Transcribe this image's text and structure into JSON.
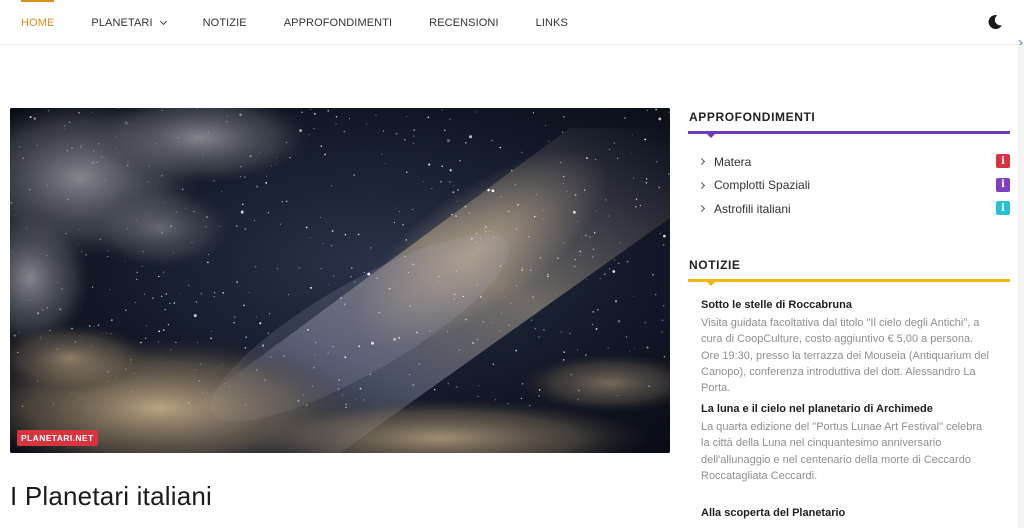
{
  "nav": {
    "items": [
      {
        "label": "HOME",
        "active": true
      },
      {
        "label": "PLANETARI",
        "has_dropdown": true
      },
      {
        "label": "NOTIZIE"
      },
      {
        "label": "APPROFONDIMENTI"
      },
      {
        "label": "RECENSIONI"
      },
      {
        "label": "LINKS"
      }
    ],
    "dark_mode_icon": "moon-icon",
    "accent_color": "#d9901a"
  },
  "hero": {
    "badge": "PLANETARI.NET",
    "badge_color": "#d8343f",
    "title": "I Planetari italiani"
  },
  "sidebar": {
    "approfondimenti": {
      "title": "APPROFONDIMENTI",
      "line_color": "#6f3cb5",
      "items": [
        {
          "label": "Matera",
          "badge_color": "#d8343f",
          "badge_icon": "info-icon"
        },
        {
          "label": "Complotti Spaziali",
          "badge_color": "#7e3fbf",
          "badge_icon": "info-icon"
        },
        {
          "label": "Astrofili italiani",
          "badge_color": "#27c0d6",
          "badge_icon": "info-icon"
        }
      ]
    },
    "notizie": {
      "title": "NOTIZIE",
      "line_color": "#f0b713",
      "items": [
        {
          "title": "Sotto le stelle di Roccabruna",
          "text": "Visita guidata facoltativa dal titolo \"Il cielo degli Antichi\", a cura di CoopCulture, costo aggiuntivo € 5,00 a persona. Ore 19:30, presso la terrazza dei Mouseia (Antiquarium del Canopo), conferenza introduttiva del dott. Alessandro La Porta."
        },
        {
          "title": "La luna e il cielo nel planetario di Archimede",
          "text": "La quarta edizione del \"Portus Lunae Art Festival\" celebra la città della Luna nel cinquantesimo anniversario dell'allunaggio e nel centenario della morte di Ceccardo Roccatagliata Ceccardi."
        },
        {
          "title": "Alla scoperta del Planetario",
          "text": ""
        }
      ]
    }
  }
}
